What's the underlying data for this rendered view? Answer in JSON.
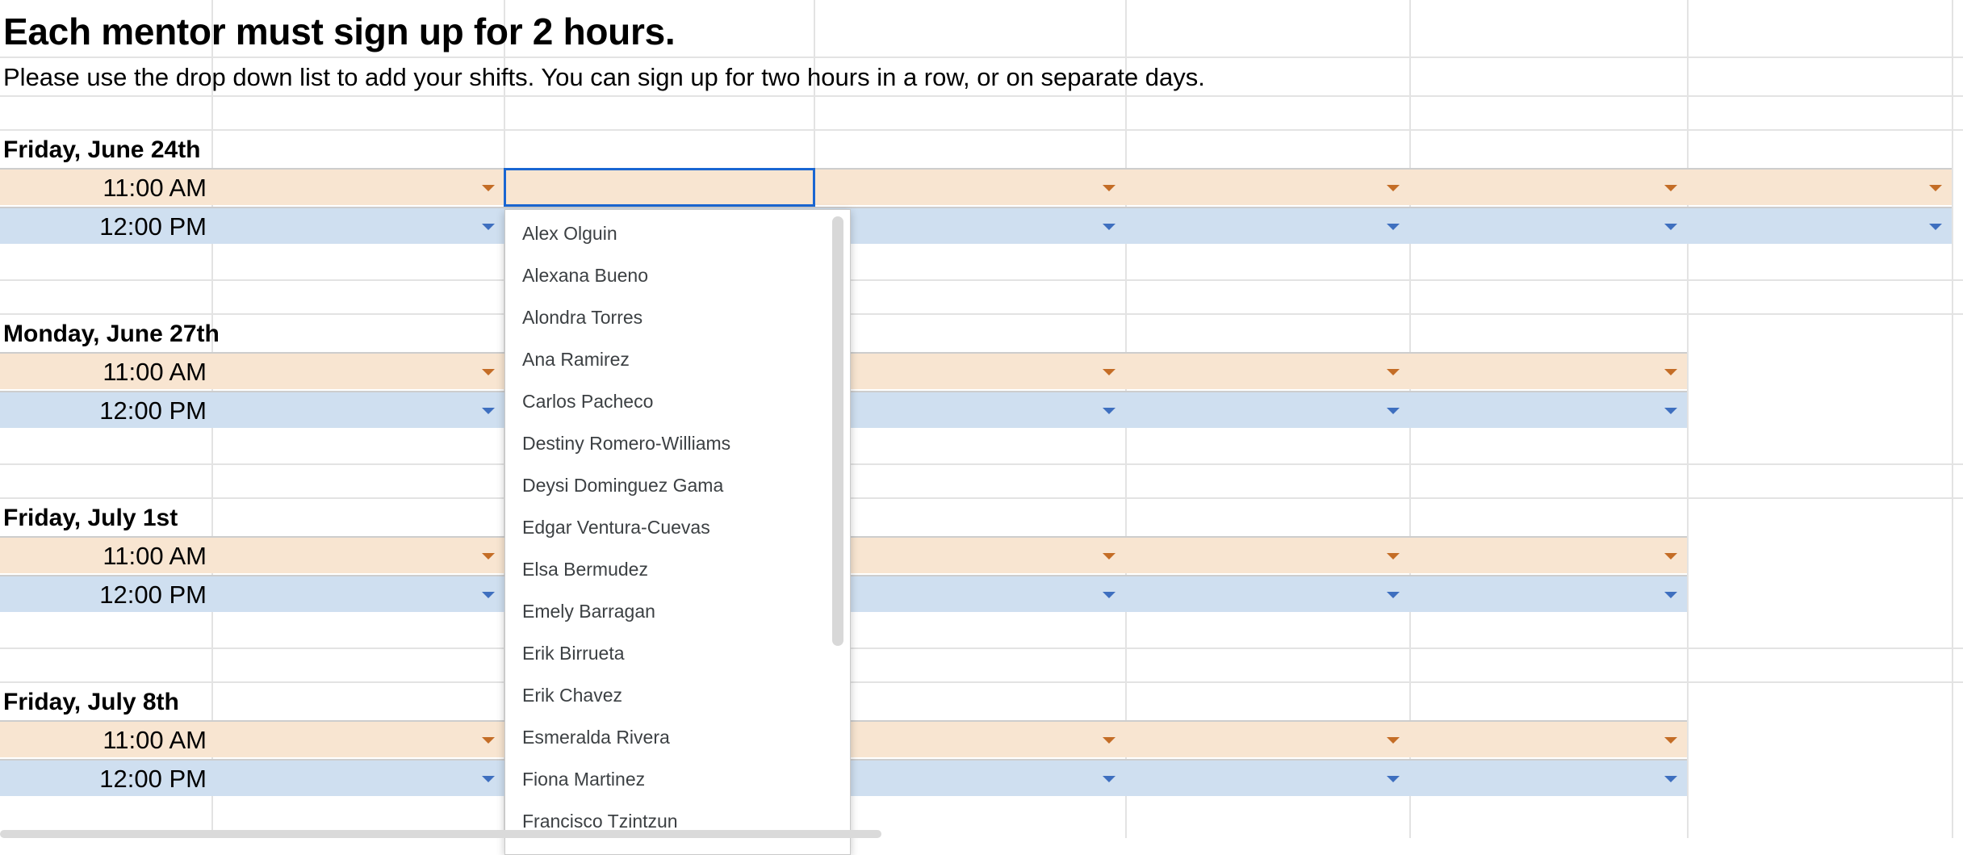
{
  "sheet": {
    "title": "Each mentor must sign up for 2 hours.",
    "subtitle": "Please use the drop down list to add your shifts. You can sign up for two hours in a row, or on separate days."
  },
  "days": [
    {
      "label": "Friday, June 24th",
      "slots": [
        {
          "time": "11:00 AM",
          "kind": "am"
        },
        {
          "time": "12:00 PM",
          "kind": "pm"
        }
      ]
    },
    {
      "label": "Monday, June 27th",
      "slots": [
        {
          "time": "11:00 AM",
          "kind": "am"
        },
        {
          "time": "12:00 PM",
          "kind": "pm"
        }
      ]
    },
    {
      "label": "Friday, July 1st",
      "slots": [
        {
          "time": "11:00 AM",
          "kind": "am"
        },
        {
          "time": "12:00 PM",
          "kind": "pm"
        }
      ]
    },
    {
      "label": "Friday, July 8th",
      "slots": [
        {
          "time": "11:00 AM",
          "kind": "am"
        },
        {
          "time": "12:00 PM",
          "kind": "pm"
        }
      ]
    }
  ],
  "dropdown": {
    "options": [
      "Alex Olguin",
      "Alexana Bueno",
      "Alondra Torres",
      "Ana Ramirez",
      "Carlos Pacheco",
      "Destiny Romero-Williams",
      "Deysi Dominguez Gama",
      "Edgar Ventura-Cuevas",
      "Elsa Bermudez",
      "Emely Barragan",
      "Erik Birrueta",
      "Erik Chavez",
      "Esmeralda Rivera",
      "Fiona Martinez",
      "Francisco Tzintzun"
    ]
  },
  "colors": {
    "am_fill": "#f8e5d1",
    "pm_fill": "#cfdff0",
    "am_arrow": "#c46d26",
    "pm_arrow": "#3e6fbf",
    "selection_border": "#1a66d2",
    "gridline": "#e3e3e3"
  }
}
